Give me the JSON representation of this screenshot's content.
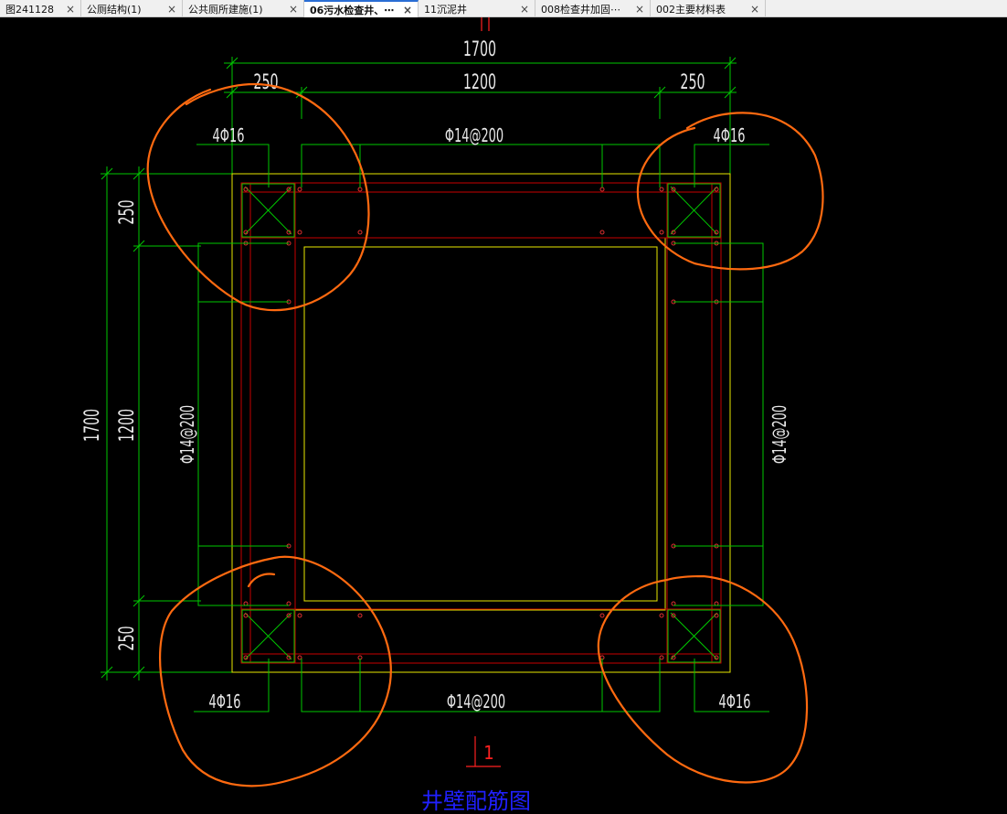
{
  "tabs": [
    {
      "label": "图241128",
      "close": "×"
    },
    {
      "label": "公厕结构(1)",
      "close": "×"
    },
    {
      "label": "公共厕所建施(1)",
      "close": "×"
    },
    {
      "label": "06污水检查井、⋯",
      "close": "×",
      "active": true
    },
    {
      "label": "11沉泥井",
      "close": "×"
    },
    {
      "label": "008检查井加固⋯",
      "close": "×"
    },
    {
      "label": "002主要材料表",
      "close": "×"
    }
  ],
  "drawing": {
    "dim_top_total": "1700",
    "dim_top_left": "250",
    "dim_top_mid": "1200",
    "dim_top_right": "250",
    "dim_left_total": "1700",
    "dim_left_top": "250",
    "dim_left_mid": "1200",
    "dim_left_bottom": "250",
    "rebar_corner_tl": "4Φ16",
    "rebar_corner_tr": "4Φ16",
    "rebar_corner_bl": "4Φ16",
    "rebar_corner_br": "4Φ16",
    "rebar_top": "Φ14@200",
    "rebar_bottom": "Φ14@200",
    "rebar_left": "Φ14@200",
    "rebar_right": "Φ14@200",
    "section_mark": "1",
    "title": "井壁配筋图"
  },
  "colors": {
    "dimension": "#00c800",
    "concrete_outline": "#e8e800",
    "rebar": "#c80000",
    "markup": "#ff6a10",
    "title": "#2020ff",
    "section": "#ff2020"
  }
}
